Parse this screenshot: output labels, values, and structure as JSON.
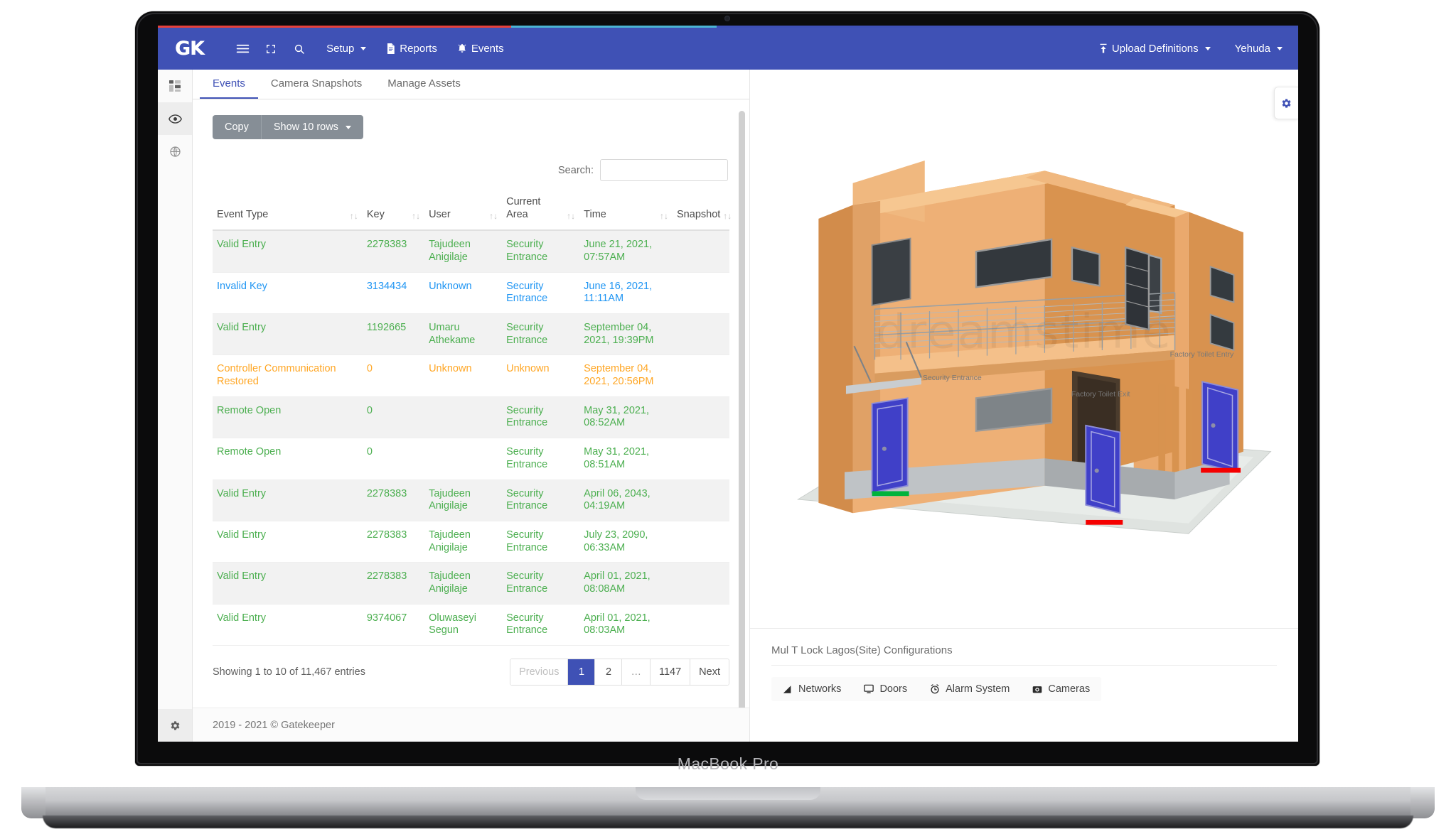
{
  "device": {
    "label": "MacBook Pro"
  },
  "navbar": {
    "logo": "GK",
    "icons": [
      {
        "name": "menu-icon"
      },
      {
        "name": "fullscreen-icon"
      },
      {
        "name": "search-icon"
      }
    ],
    "items": [
      {
        "label": "Setup",
        "icon": "",
        "caret": true
      },
      {
        "label": "Reports",
        "icon": "file-icon",
        "caret": false
      },
      {
        "label": "Events",
        "icon": "bell-icon",
        "caret": false
      }
    ],
    "right": [
      {
        "label": "Upload Definitions",
        "icon": "upload-icon",
        "caret": true
      },
      {
        "label": "Yehuda",
        "icon": "",
        "caret": true
      }
    ],
    "bg_color": "#3f51b5",
    "progress_colors": [
      "#e7413b",
      "#4bb4d4",
      "#3d4fb5"
    ]
  },
  "rail": {
    "items": [
      {
        "name": "dashboard-icon",
        "active": false
      },
      {
        "name": "eye-icon",
        "active": true
      },
      {
        "name": "globe-icon",
        "active": false
      }
    ],
    "bottom": {
      "name": "gear-icon"
    }
  },
  "tabs": [
    {
      "label": "Events",
      "active": true
    },
    {
      "label": "Camera Snapshots",
      "active": false
    },
    {
      "label": "Manage Assets",
      "active": false
    }
  ],
  "toolbar": {
    "copy_label": "Copy",
    "show_rows_label": "Show 10 rows"
  },
  "search": {
    "label": "Search:",
    "value": "",
    "placeholder": ""
  },
  "table": {
    "columns": [
      "Event Type",
      "Key",
      "User",
      "Current Area",
      "Time",
      "Snapshot"
    ],
    "rows": [
      {
        "type": "Valid Entry",
        "key": "2278383",
        "user": "Tajudeen Anigilaje",
        "area": "Security Entrance",
        "time": "June 21, 2021, 07:57AM",
        "snapshot": "",
        "color": "green"
      },
      {
        "type": "Invalid Key",
        "key": "3134434",
        "user": "Unknown",
        "area": "Security Entrance",
        "time": "June 16, 2021, 11:11AM",
        "snapshot": "",
        "color": "blue"
      },
      {
        "type": "Valid Entry",
        "key": "1192665",
        "user": "Umaru Athekame",
        "area": "Security Entrance",
        "time": "September 04, 2021, 19:39PM",
        "snapshot": "",
        "color": "green"
      },
      {
        "type": "Controller Communication Restored",
        "key": "0",
        "user": "Unknown",
        "area": "Unknown",
        "time": "September 04, 2021, 20:56PM",
        "snapshot": "",
        "color": "orange"
      },
      {
        "type": "Remote Open",
        "key": "0",
        "user": "",
        "area": "Security Entrance",
        "time": "May 31, 2021, 08:52AM",
        "snapshot": "",
        "color": "green"
      },
      {
        "type": "Remote Open",
        "key": "0",
        "user": "",
        "area": "Security Entrance",
        "time": "May 31, 2021, 08:51AM",
        "snapshot": "",
        "color": "green"
      },
      {
        "type": "Valid Entry",
        "key": "2278383",
        "user": "Tajudeen Anigilaje",
        "area": "Security Entrance",
        "time": "April 06, 2043, 04:19AM",
        "snapshot": "",
        "color": "green"
      },
      {
        "type": "Valid Entry",
        "key": "2278383",
        "user": "Tajudeen Anigilaje",
        "area": "Security Entrance",
        "time": "July 23, 2090, 06:33AM",
        "snapshot": "",
        "color": "green"
      },
      {
        "type": "Valid Entry",
        "key": "2278383",
        "user": "Tajudeen Anigilaje",
        "area": "Security Entrance",
        "time": "April 01, 2021, 08:08AM",
        "snapshot": "",
        "color": "green"
      },
      {
        "type": "Valid Entry",
        "key": "9374067",
        "user": "Oluwaseyi Segun",
        "area": "Security Entrance",
        "time": "April 01, 2021, 08:03AM",
        "snapshot": "",
        "color": "green"
      }
    ]
  },
  "pagination": {
    "info": "Showing 1 to 10 of 11,467 entries",
    "previous": "Previous",
    "pages": [
      "1",
      "2",
      "…",
      "1147"
    ],
    "active_page": "1",
    "next": "Next"
  },
  "footer": {
    "copyright": "2019 - 2021 © Gatekeeper"
  },
  "viewer": {
    "settings_icon": "gear-icon",
    "watermark": "dreamstime",
    "door_labels": [
      {
        "text": "Security Entrance",
        "status": "green"
      },
      {
        "text": "Factory Toilet Exit",
        "status": "red"
      },
      {
        "text": "Factory Toilet Entry",
        "status": "red"
      }
    ]
  },
  "config": {
    "title": "Mul T Lock Lagos(Site) Configurations",
    "tabs": [
      {
        "label": "Networks",
        "icon": "network-icon"
      },
      {
        "label": "Doors",
        "icon": "door-icon"
      },
      {
        "label": "Alarm System",
        "icon": "alarm-icon"
      },
      {
        "label": "Cameras",
        "icon": "camera-icon"
      }
    ]
  },
  "colors": {
    "accent": "#3f51b5",
    "valid": "#4caf50",
    "invalid": "#2196f3",
    "warning": "#ffa726",
    "building": "#e8a96a",
    "door": "#3f3fbf"
  }
}
